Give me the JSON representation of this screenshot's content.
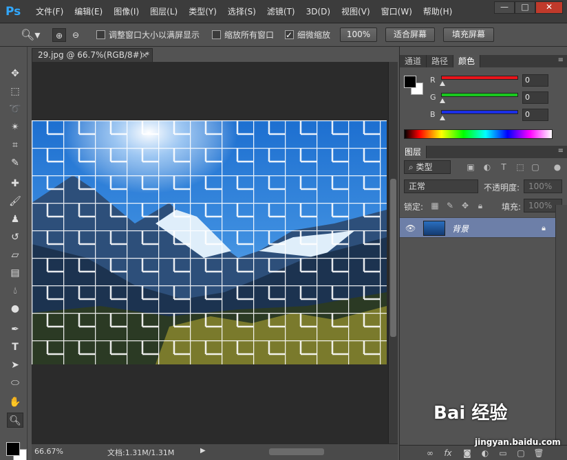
{
  "app": {
    "logo": "Ps"
  },
  "menu": [
    "文件(F)",
    "编辑(E)",
    "图像(I)",
    "图层(L)",
    "类型(Y)",
    "选择(S)",
    "滤镜(T)",
    "3D(D)",
    "视图(V)",
    "窗口(W)",
    "帮助(H)"
  ],
  "window_controls": {
    "minimize": "—",
    "maximize": "□",
    "close": "✕"
  },
  "options": {
    "resize_windows": "调整窗口大小以满屏显示",
    "zoom_all": "缩放所有窗口",
    "scrubby_zoom": "细微缩放",
    "btn_100": "100%",
    "btn_fit": "适合屏幕",
    "btn_fill": "填充屏幕",
    "resize_checked": false,
    "zoom_all_checked": false,
    "scrubby_checked": true
  },
  "document": {
    "tab_title": "29.jpg @ 66.7%(RGB/8#) *",
    "close": "×"
  },
  "status": {
    "zoom": "66.67%",
    "doc_info": "文档:1.31M/1.31M",
    "arrow": "▶"
  },
  "color_panel": {
    "tabs": [
      "通道",
      "路径",
      "颜色"
    ],
    "active_tab": "颜色",
    "r_label": "R",
    "g_label": "G",
    "b_label": "B",
    "r_value": "0",
    "g_value": "0",
    "b_value": "0",
    "r_color": "#e8141a",
    "g_color": "#19c81e",
    "b_color": "#1a2ee8"
  },
  "layers_panel": {
    "tab": "图层",
    "kind_filter": "⌕ 类型",
    "blend_mode": "正常",
    "opacity_label": "不透明度:",
    "opacity_value": "100%",
    "lock_label": "锁定:",
    "fill_label": "填充:",
    "fill_value": "100%",
    "layer_name": "背景",
    "selected_layer_color": "#6d7fa8"
  },
  "watermark": {
    "text": "Bai 经验",
    "url": "jingyan.baidu.com"
  },
  "colors": {
    "ps_blue": "#31a8ff",
    "panel_bg": "#535353",
    "canvas_bg": "#2b2b2b"
  }
}
